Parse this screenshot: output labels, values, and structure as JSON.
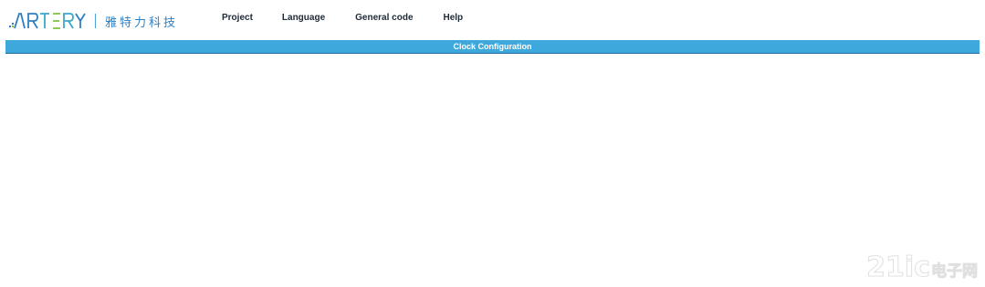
{
  "brand": {
    "logo_text": "ARTERY",
    "company_name_cn": "雅特力科技",
    "colors": {
      "logo_blue": "#2f7fc0",
      "logo_green": "#7cc242",
      "logo_yellow": "#f0b323"
    }
  },
  "menu": {
    "items": [
      {
        "label": "Project"
      },
      {
        "label": "Language"
      },
      {
        "label": "General code"
      },
      {
        "label": "Help"
      }
    ]
  },
  "title_bar": {
    "title": "Clock Configuration",
    "color": "#3ea8dd"
  },
  "watermark": {
    "number": "21ic",
    "text_cn": "电子网"
  }
}
